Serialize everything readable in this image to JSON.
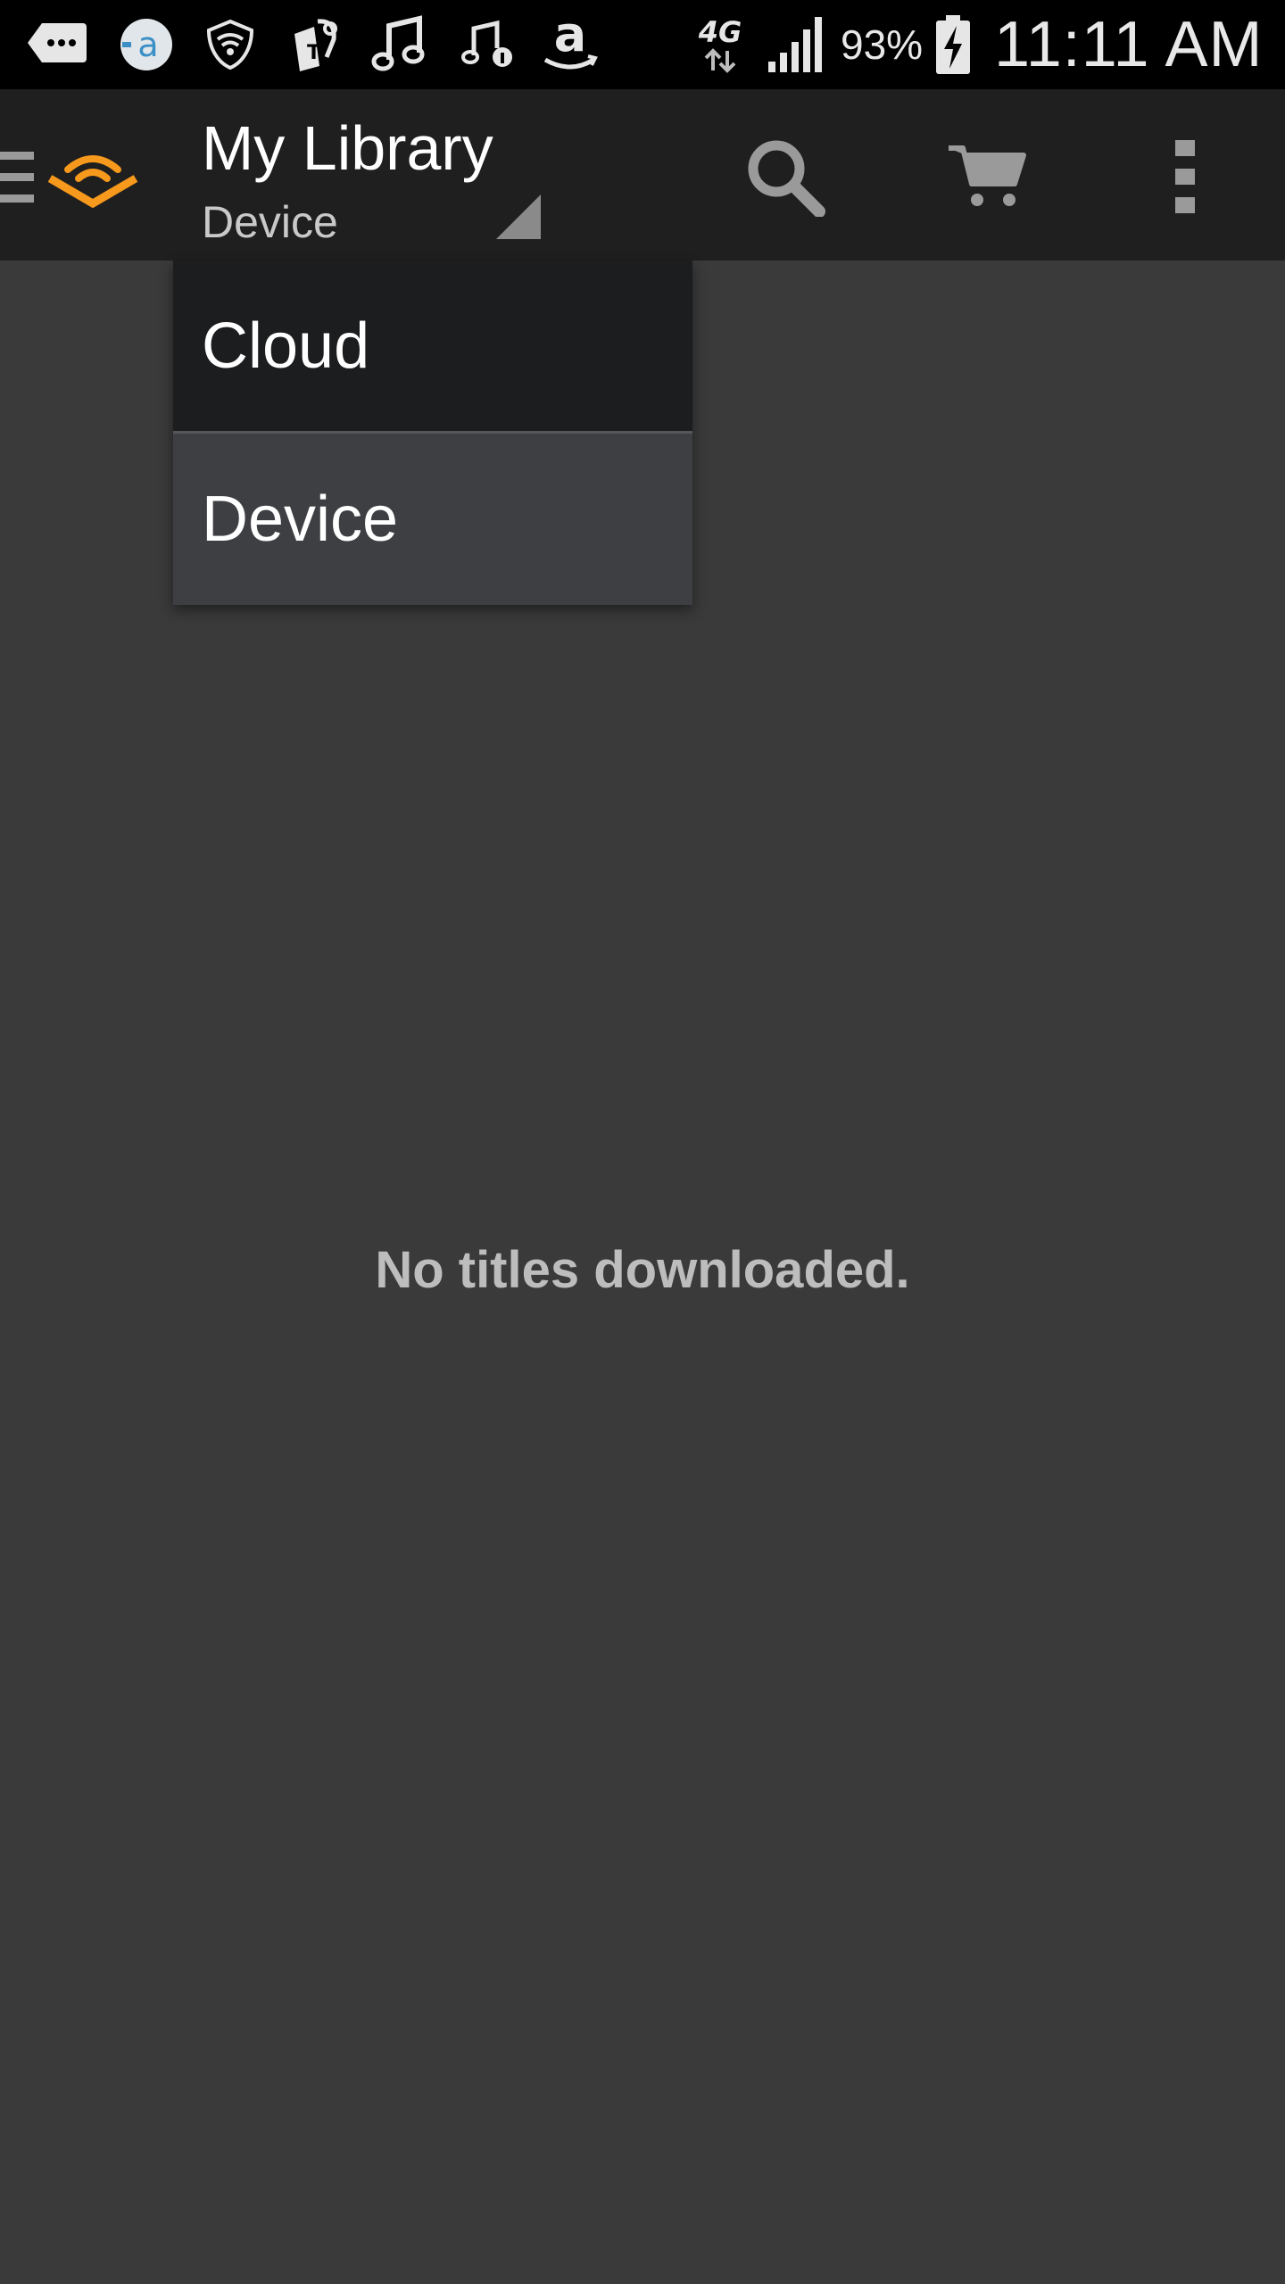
{
  "status_bar": {
    "battery_percent": "93%",
    "time": "11:11 AM",
    "network_label": "4G",
    "icons": [
      "messages-icon",
      "audible-app-icon",
      "wifi-shield-icon",
      "tmobile-icon",
      "music-icon",
      "music-info-icon",
      "amazon-icon",
      "network-4g-icon",
      "signal-icon",
      "battery-charging-icon"
    ]
  },
  "app_bar": {
    "title": "My Library",
    "subtitle": "Device",
    "accent_color": "#f7991c",
    "icons": [
      "menu-icon",
      "audible-logo-icon",
      "search-icon",
      "cart-icon",
      "overflow-menu-icon"
    ]
  },
  "dropdown": {
    "items": [
      {
        "label": "Cloud",
        "selected": false
      },
      {
        "label": "Device",
        "selected": true
      }
    ]
  },
  "main": {
    "empty_message": "No titles downloaded."
  }
}
